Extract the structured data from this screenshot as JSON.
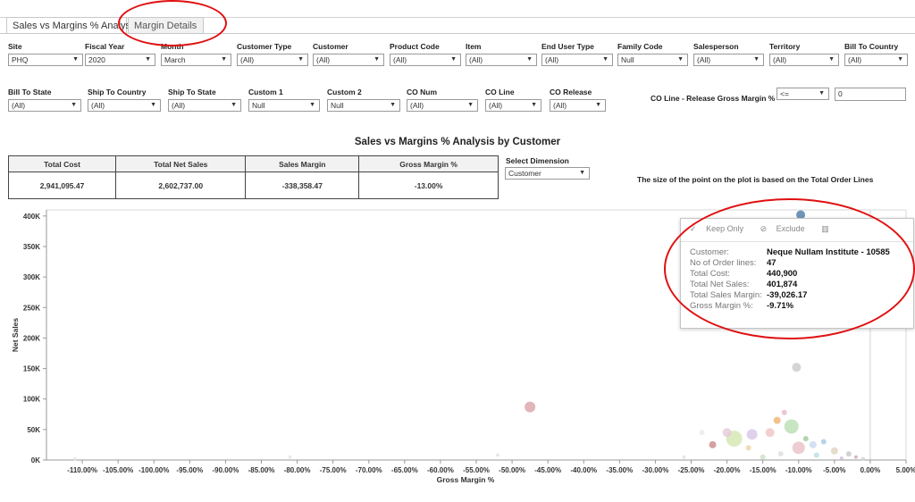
{
  "tabs": [
    {
      "label": "Sales vs Margins % Analysis",
      "active": true
    },
    {
      "label": "Margin Details",
      "active": false
    }
  ],
  "filters_row1": [
    {
      "label": "Site",
      "value": "PHQ"
    },
    {
      "label": "Fiscal Year",
      "value": "2020"
    },
    {
      "label": "Month",
      "value": "March"
    },
    {
      "label": "Customer Type",
      "value": "(All)"
    },
    {
      "label": "Customer",
      "value": "(All)"
    },
    {
      "label": "Product Code",
      "value": "(All)"
    },
    {
      "label": "Item",
      "value": "(All)"
    },
    {
      "label": "End User Type",
      "value": "(All)"
    },
    {
      "label": "Family Code",
      "value": "Null"
    },
    {
      "label": "Salesperson",
      "value": "(All)"
    },
    {
      "label": "Territory",
      "value": "(All)"
    },
    {
      "label": "Bill To Country",
      "value": "(All)"
    }
  ],
  "filters_row2": [
    {
      "label": "Bill To State",
      "value": "(All)"
    },
    {
      "label": "Ship To Country",
      "value": "(All)"
    },
    {
      "label": "Ship To State",
      "value": "(All)"
    },
    {
      "label": "Custom 1",
      "value": "Null"
    },
    {
      "label": "Custom 2",
      "value": "Null"
    },
    {
      "label": "CO Num",
      "value": "(All)"
    },
    {
      "label": "CO Line",
      "value": "(All)"
    },
    {
      "label": "CO Release",
      "value": "(All)"
    }
  ],
  "release_filter": {
    "label": "CO Line - Release Gross Margin %",
    "operator": "<=",
    "value": "0"
  },
  "dashboard_title": "Sales vs Margins % Analysis by Customer",
  "kpis": {
    "headers": [
      "Total Cost",
      "Total Net Sales",
      "Sales Margin",
      "Gross Margin %"
    ],
    "values": [
      "2,941,095.47",
      "2,602,737.00",
      "-338,358.47",
      "-13.00%"
    ]
  },
  "dimension": {
    "label": "Select Dimension",
    "value": "Customer"
  },
  "note": "The size of the point on the plot is based on the Total Order Lines",
  "tooltip": {
    "keep_only": "Keep Only",
    "exclude": "Exclude",
    "rows": [
      {
        "key": "Customer:",
        "value": "Neque Nullam Institute - 10585"
      },
      {
        "key": "No of Order lines:",
        "value": "47"
      },
      {
        "key": "Total Cost:",
        "value": "440,900"
      },
      {
        "key": "Total Net Sales:",
        "value": "401,874"
      },
      {
        "key": "Total Sales Margin:",
        "value": "-39,026.17"
      },
      {
        "key": "Gross Margin %:",
        "value": "-9.71%"
      }
    ]
  },
  "chart_data": {
    "type": "scatter",
    "xlabel": "Gross Margin %",
    "ylabel": "Net Sales",
    "xlim": [
      -115,
      5
    ],
    "ylim": [
      0,
      410000
    ],
    "x_ticks": [
      "-110.00%",
      "-105.00%",
      "-100.00%",
      "-95.00%",
      "-90.00%",
      "-85.00%",
      "-80.00%",
      "-75.00%",
      "-70.00%",
      "-65.00%",
      "-60.00%",
      "-55.00%",
      "-50.00%",
      "-45.00%",
      "-40.00%",
      "-35.00%",
      "-30.00%",
      "-25.00%",
      "-20.00%",
      "-15.00%",
      "-10.00%",
      "-5.00%",
      "0.00%",
      "5.00%"
    ],
    "y_ticks": [
      "0K",
      "50K",
      "100K",
      "150K",
      "200K",
      "250K",
      "300K",
      "350K",
      "400K"
    ],
    "grid": false,
    "points": [
      {
        "x": -47.5,
        "y": 87000,
        "r": 6,
        "color": "#d9a3a8"
      },
      {
        "x": -10.3,
        "y": 152000,
        "r": 5,
        "color": "#c9c9c9"
      },
      {
        "x": -9.71,
        "y": 401874,
        "r": 5,
        "color": "#4e79a7"
      },
      {
        "x": -19.0,
        "y": 35000,
        "r": 9,
        "color": "#d4e6b0"
      },
      {
        "x": -11.0,
        "y": 55000,
        "r": 8,
        "color": "#b9dfb0"
      },
      {
        "x": -14.0,
        "y": 45000,
        "r": 5,
        "color": "#f1c3c3"
      },
      {
        "x": -13.0,
        "y": 65000,
        "r": 4,
        "color": "#f0b36f"
      },
      {
        "x": -12.0,
        "y": 78000,
        "r": 3,
        "color": "#e7b6cf"
      },
      {
        "x": -22.0,
        "y": 25000,
        "r": 4,
        "color": "#c88a8a"
      },
      {
        "x": -20.0,
        "y": 45000,
        "r": 5,
        "color": "#e5c9d8"
      },
      {
        "x": -16.5,
        "y": 42000,
        "r": 6,
        "color": "#d7c5e8"
      },
      {
        "x": -10.0,
        "y": 20000,
        "r": 7,
        "color": "#e8c0c6"
      },
      {
        "x": -8.0,
        "y": 25000,
        "r": 4,
        "color": "#c9d9ef"
      },
      {
        "x": -6.5,
        "y": 30000,
        "r": 3,
        "color": "#a8c8e8"
      },
      {
        "x": -5.0,
        "y": 15000,
        "r": 4,
        "color": "#ddd5c0"
      },
      {
        "x": -3.0,
        "y": 10000,
        "r": 3,
        "color": "#c7c7c7"
      },
      {
        "x": -2.0,
        "y": 5000,
        "r": 2,
        "color": "#d5a8a8"
      },
      {
        "x": -7.5,
        "y": 8000,
        "r": 3,
        "color": "#b7dfe3"
      },
      {
        "x": -12.5,
        "y": 10000,
        "r": 3,
        "color": "#dddddd"
      },
      {
        "x": -15.0,
        "y": 5000,
        "r": 3,
        "color": "#c9e2c2"
      },
      {
        "x": -17.0,
        "y": 20000,
        "r": 3,
        "color": "#e9d4a8"
      },
      {
        "x": -23.5,
        "y": 45000,
        "r": 3,
        "color": "#eaeaea"
      },
      {
        "x": -9.0,
        "y": 35000,
        "r": 3,
        "color": "#9fc99a"
      },
      {
        "x": -4.0,
        "y": 3000,
        "r": 2,
        "color": "#d2b9dc"
      },
      {
        "x": -1.0,
        "y": 2000,
        "r": 2,
        "color": "#cfcfcf"
      },
      {
        "x": -26.0,
        "y": 5000,
        "r": 2,
        "color": "#e1e1e1"
      },
      {
        "x": -52.0,
        "y": 8000,
        "r": 2,
        "color": "#e3e3e3"
      },
      {
        "x": -111.0,
        "y": 2000,
        "r": 2,
        "color": "#e3e3e3"
      },
      {
        "x": -81.0,
        "y": 5000,
        "r": 2,
        "color": "#e6e6e6"
      }
    ]
  }
}
